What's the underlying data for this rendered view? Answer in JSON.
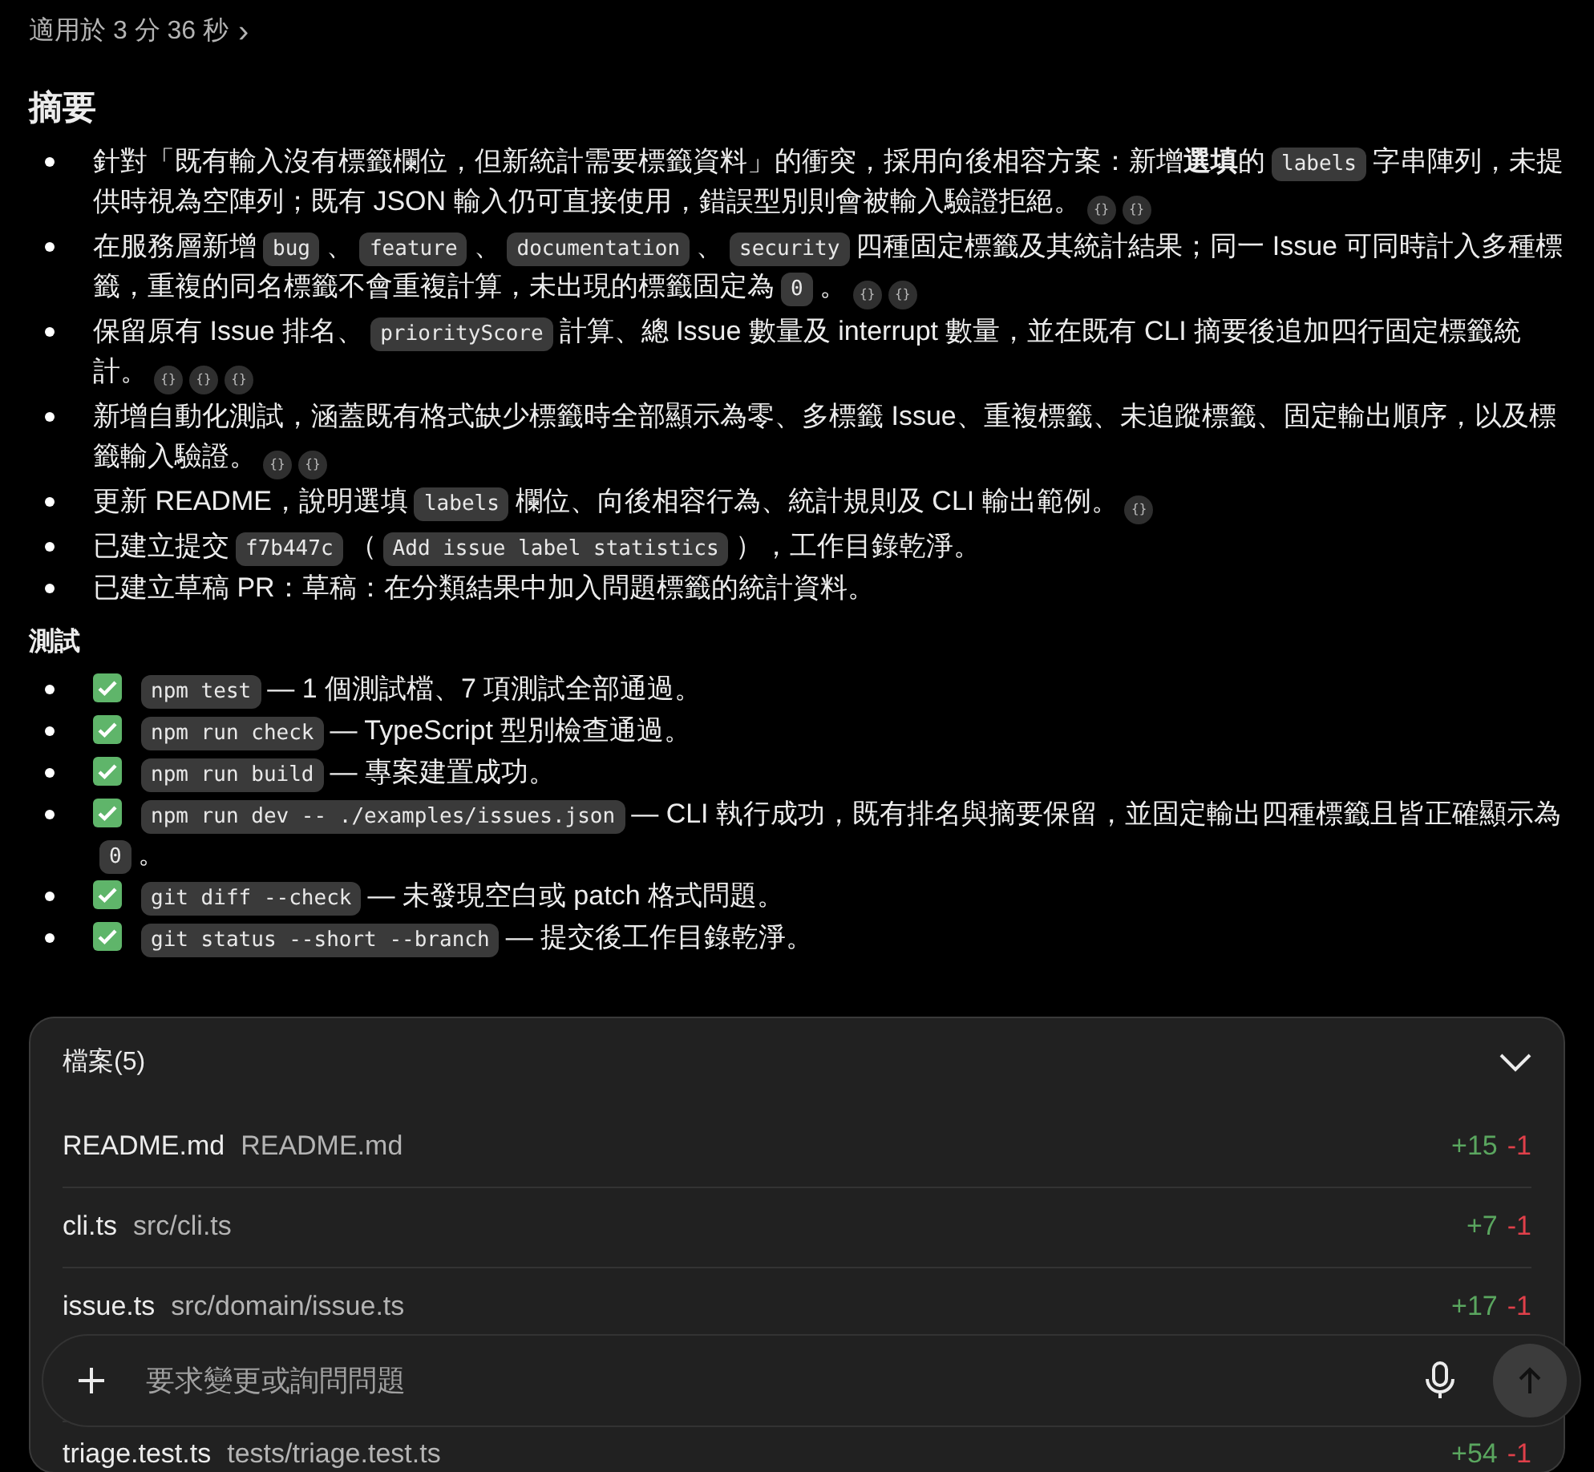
{
  "header": {
    "duration": "適用於 3 分 36 秒",
    "chevron": "›"
  },
  "summary": {
    "title": "摘要",
    "items": [
      [
        {
          "kind": "text",
          "text": "針對「既有輸入沒有標籤欄位，但新統計需要標籤資料」的衝突，採用向後相容方案：新增**選填**的"
        },
        {
          "kind": "code",
          "text": "labels"
        },
        {
          "kind": "text",
          "text": "字串陣列，未提供時視為空陣列；既有 JSON 輸入仍可直接使用，錯誤型別則會被輸入驗證拒絕。"
        },
        {
          "kind": "cite",
          "text": "{}"
        },
        {
          "kind": "cite",
          "text": "{}"
        }
      ],
      [
        {
          "kind": "text",
          "text": "在服務層新增"
        },
        {
          "kind": "code",
          "text": "bug"
        },
        {
          "kind": "text",
          "text": "、"
        },
        {
          "kind": "code",
          "text": "feature"
        },
        {
          "kind": "text",
          "text": "、"
        },
        {
          "kind": "code",
          "text": "documentation"
        },
        {
          "kind": "text",
          "text": "、"
        },
        {
          "kind": "code",
          "text": "security"
        },
        {
          "kind": "text",
          "text": "四種固定標籤及其統計結果；同一 Issue 可同時計入多種標籤，重複的同名標籤不會重複計算，未出現的標籤固定為"
        },
        {
          "kind": "code",
          "text": "0"
        },
        {
          "kind": "text",
          "text": "。"
        },
        {
          "kind": "cite",
          "text": "{}"
        },
        {
          "kind": "cite",
          "text": "{}"
        }
      ],
      [
        {
          "kind": "text",
          "text": "保留原有 Issue 排名、"
        },
        {
          "kind": "code",
          "text": "priorityScore"
        },
        {
          "kind": "text",
          "text": "計算、總 Issue 數量及 interrupt 數量，並在既有 CLI 摘要後追加四行固定標籤統計。"
        },
        {
          "kind": "cite",
          "text": "{}"
        },
        {
          "kind": "cite",
          "text": "{}"
        },
        {
          "kind": "cite",
          "text": "{}"
        }
      ],
      [
        {
          "kind": "text",
          "text": "新增自動化測試，涵蓋既有格式缺少標籤時全部顯示為零、多標籤 Issue、重複標籤、未追蹤標籤、固定輸出順序，以及標籤輸入驗證。"
        },
        {
          "kind": "cite",
          "text": "{}"
        },
        {
          "kind": "cite",
          "text": "{}"
        }
      ],
      [
        {
          "kind": "text",
          "text": "更新 README，說明選填"
        },
        {
          "kind": "code",
          "text": "labels"
        },
        {
          "kind": "text",
          "text": "欄位、向後相容行為、統計規則及 CLI 輸出範例。"
        },
        {
          "kind": "cite",
          "text": "{}"
        }
      ],
      [
        {
          "kind": "text",
          "text": "已建立提交"
        },
        {
          "kind": "code",
          "text": "f7b447c"
        },
        {
          "kind": "text",
          "text": "（"
        },
        {
          "kind": "code",
          "text": "Add issue label statistics"
        },
        {
          "kind": "text",
          "text": "），工作目錄乾淨。"
        }
      ],
      [
        {
          "kind": "text",
          "text": "已建立草稿 PR：草稿：在分類結果中加入問題標籤的統計資料。"
        }
      ]
    ]
  },
  "tests": {
    "title": "測試",
    "items": [
      {
        "passed": true,
        "segments": [
          {
            "kind": "code",
            "text": "npm test"
          },
          {
            "kind": "text",
            "text": "— 1 個測試檔、7 項測試全部通過。"
          }
        ]
      },
      {
        "passed": true,
        "segments": [
          {
            "kind": "code",
            "text": "npm run check"
          },
          {
            "kind": "text",
            "text": "— TypeScript 型別檢查通過。"
          }
        ]
      },
      {
        "passed": true,
        "segments": [
          {
            "kind": "code",
            "text": "npm run build"
          },
          {
            "kind": "text",
            "text": "— 專案建置成功。"
          }
        ]
      },
      {
        "passed": true,
        "segments": [
          {
            "kind": "code",
            "text": "npm run dev -- ./examples/issues.json"
          },
          {
            "kind": "text",
            "text": "— CLI 執行成功，既有排名與摘要保留，並固定輸出四種標籤且皆正確顯示為"
          },
          {
            "kind": "code",
            "text": "0"
          },
          {
            "kind": "text",
            "text": "。"
          }
        ]
      },
      {
        "passed": true,
        "segments": [
          {
            "kind": "code",
            "text": "git diff --check"
          },
          {
            "kind": "text",
            "text": "— 未發現空白或 patch 格式問題。"
          }
        ]
      },
      {
        "passed": true,
        "segments": [
          {
            "kind": "code",
            "text": "git status --short --branch"
          },
          {
            "kind": "text",
            "text": "— 提交後工作目錄乾淨。"
          }
        ]
      }
    ]
  },
  "files": {
    "title": "檔案(5)",
    "expanded": true,
    "items": [
      {
        "name": "README.md",
        "path": "README.md",
        "added": "+15",
        "removed": "-1"
      },
      {
        "name": "cli.ts",
        "path": "src/cli.ts",
        "added": "+7",
        "removed": "-1"
      },
      {
        "name": "issue.ts",
        "path": "src/domain/issue.ts",
        "added": "+17",
        "removed": "-1"
      },
      {
        "name": "triage.test.ts",
        "path": "tests/triage.test.ts",
        "added": "+54",
        "removed": "-1"
      }
    ]
  },
  "composer": {
    "placeholder": "要求變更或詢問問題"
  }
}
